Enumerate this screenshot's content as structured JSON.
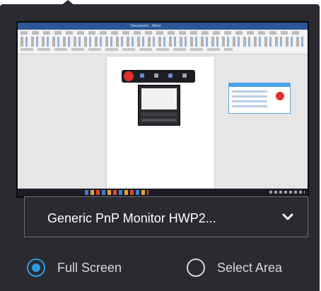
{
  "preview": {
    "titlebar_text": "Document1 - Word"
  },
  "monitor_select": {
    "label": "Generic PnP Monitor HWP2...",
    "icon": "chevron-down-icon"
  },
  "capture_mode": {
    "options": [
      {
        "label": "Full Screen",
        "selected": true
      },
      {
        "label": "Select Area",
        "selected": false
      }
    ]
  },
  "colors": {
    "panel_bg": "#2a2a30",
    "accent": "#2f9be0",
    "record_red": "#e0312f"
  }
}
